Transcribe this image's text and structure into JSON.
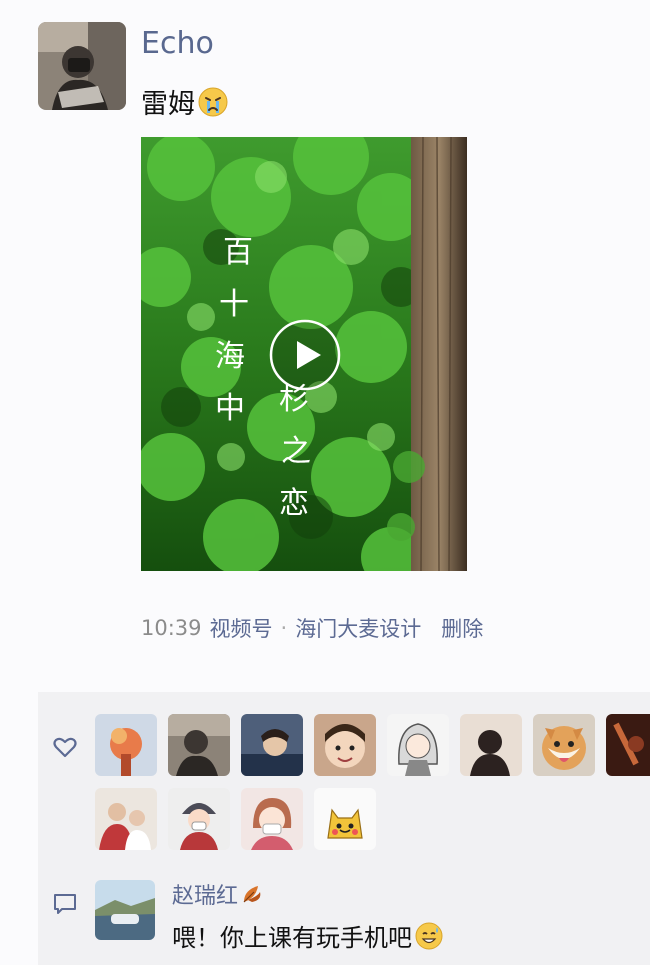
{
  "post": {
    "author": "Echo",
    "caption": "雷姆",
    "caption_emoji": "crying-face-icon",
    "video": {
      "overlay_title_left": "百十海中",
      "overlay_title_right": "杉之恋"
    },
    "meta": {
      "time": "10:39",
      "channel_label": "视频号",
      "separator": "·",
      "channel_name": "海门大麦设计",
      "delete_label": "删除"
    }
  },
  "likes": {
    "icon": "heart-icon",
    "avatar_count_visible": 12
  },
  "comments": [
    {
      "name": "赵瑞红",
      "name_emoji": "autumn-leaf-icon",
      "text": "喂！你上课有玩手机吧",
      "text_emoji": "sweat-smile-icon"
    }
  ],
  "colors": {
    "link": "#5c6a93",
    "author": "#59688f",
    "meta": "#8b8b8b",
    "panel": "#f1f1f3"
  }
}
